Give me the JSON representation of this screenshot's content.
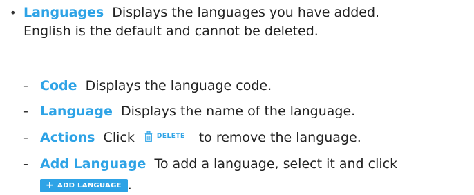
{
  "bullet": {
    "symbol": "•",
    "term": "Languages",
    "desc_line1": "Displays the languages you have added.",
    "desc_line2": "English is the default and cannot be deleted."
  },
  "sub_items": [
    {
      "dash": "-",
      "term": "Code",
      "desc": "Displays the language code."
    },
    {
      "dash": "-",
      "term": "Language",
      "desc": "Displays the name of the language."
    },
    {
      "dash": "-",
      "term": "Actions",
      "pre": "Click",
      "delete_label": "DELETE",
      "post": "to remove the language."
    },
    {
      "dash": "-",
      "term": "Add Language",
      "desc": "To add a language, select it and click",
      "button_label": "ADD LANGUAGE",
      "end": "."
    }
  ],
  "colors": {
    "accent": "#2ea3e6",
    "text": "#222222"
  },
  "icons": {
    "delete": "trash-icon",
    "add": "plus-icon"
  }
}
